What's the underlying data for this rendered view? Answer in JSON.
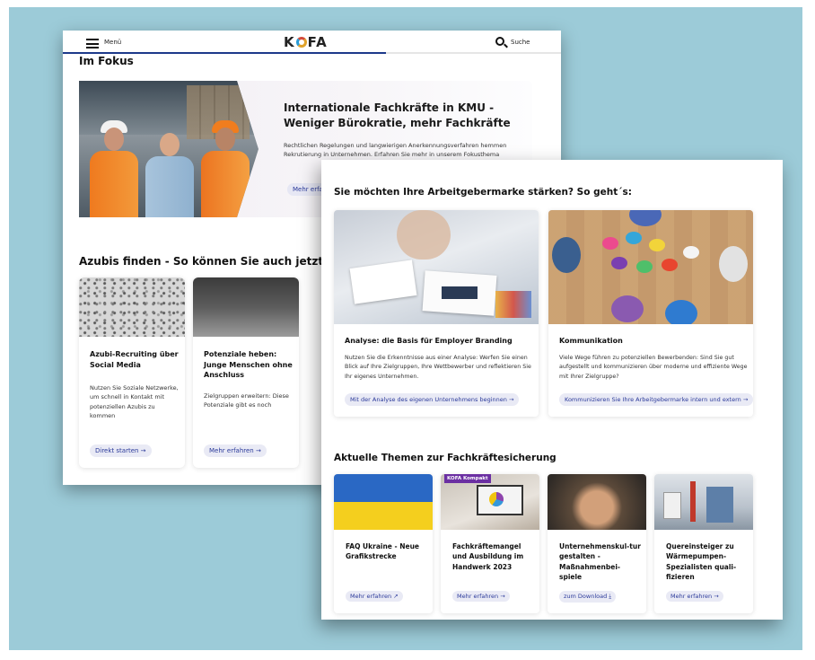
{
  "back_page": {
    "header": {
      "menu_label": "Menü",
      "logo_left": "K",
      "logo_right": "FA",
      "search_label": "Suche"
    },
    "focus_heading": "Im Fokus",
    "hero": {
      "title": "Internationale Fachkräfte in KMU - Weniger Bürokratie, mehr Fachkräfte",
      "text": "Rechtlichen Regelungen und langwierigen Anerkennungsverfahren hemmen Rekrutierung in Unternehmen. Erfahren Sie mehr in unserem Fokusthema",
      "link": "Mehr erfahren"
    },
    "azubis_heading": "Azubis finden - So können Sie auch jetzt noc",
    "cards": [
      {
        "title": "Azubi-Recruiting über Social Media",
        "text": "Nutzen Sie Soziale Netzwerke, um schnell in Kontakt mit potenziellen Azubis zu kommen",
        "link": "Direkt starten →"
      },
      {
        "title": "Potenziale heben: Junge Menschen ohne Anschluss",
        "text": "Zielgruppen erweitern: Diese Potenziale gibt es noch",
        "link": "Mehr erfahren →"
      }
    ]
  },
  "front_page": {
    "heading": "Sie möchten Ihre Arbeitgebermarke stärken? So geht´s:",
    "feature_cards": [
      {
        "title": "Analyse: die Basis für Employer Branding",
        "text": "Nutzen Sie die Erkenntnisse aus einer Analyse: Werfen Sie einen Blick auf Ihre Zielgruppen, Ihre Wettbewerber und reflektieren Sie Ihr eigenes Unternehmen.",
        "link": "Mit der Analyse des eigenen Unternehmens beginnen →"
      },
      {
        "title": "Kommunikation",
        "text": "Viele Wege führen zu potenziellen Bewerbenden: Sind Sie gut aufgestellt und kommunizieren über moderne und effiziente Wege mit Ihrer Zielgruppe?",
        "link": "Kommunizieren Sie Ihre Arbeitgebermarke intern und extern →"
      }
    ],
    "topics_heading": "Aktuelle Themen zur Fachkräftesicherung",
    "topic_cards": [
      {
        "title": "FAQ Ukraine - Neue Grafikstrecke",
        "link": "Mehr erfahren ↗",
        "badge": ""
      },
      {
        "title": "Fachkräftemangel und Ausbildung im Handwerk 2023",
        "link": "Mehr erfahren →",
        "badge": "KOFA Kompakt"
      },
      {
        "title": "Unternehmenskul-tur gestalten - Maßnahmenbei-spiele",
        "link": "zum Download ⤓",
        "badge": ""
      },
      {
        "title": "Quereinsteiger zu Wärmepumpen-Spezialisten quali-fizieren",
        "link": "Mehr erfahren →",
        "badge": ""
      }
    ]
  },
  "colors": {
    "frame_bg": "#9ccbd8",
    "link_blue": "#2b3a9a",
    "nav_accent": "#1d3a8a",
    "badge_purple": "#6b2fa2"
  }
}
